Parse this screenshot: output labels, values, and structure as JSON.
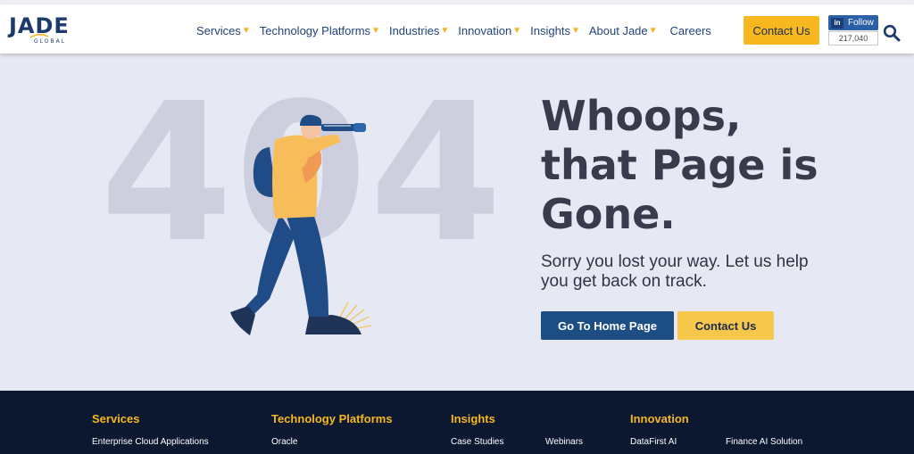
{
  "header": {
    "logo": {
      "word": "JADE",
      "sub": "GLOBAL"
    },
    "nav": [
      {
        "label": "Services",
        "caret": "▼"
      },
      {
        "label": "Technology Platforms",
        "caret": "▼"
      },
      {
        "label": "Industries",
        "caret": "▼"
      },
      {
        "label": "Innovation",
        "caret": "▼"
      },
      {
        "label": "Insights",
        "caret": "▼"
      },
      {
        "label": "About Jade",
        "caret": "▼"
      },
      {
        "label": "Careers",
        "caret": ""
      }
    ],
    "contact_button": "Contact Us",
    "linkedin": {
      "logo": "in",
      "follow": "Follow",
      "count": "217,040"
    },
    "search_icon": "search-icon"
  },
  "main": {
    "big_number": "404",
    "headline": [
      "Whoops,",
      "that Page is",
      "Gone."
    ],
    "subtext": "Sorry you lost your way. Let us help you get back on track.",
    "home_button": "Go To Home Page",
    "contact_button": "Contact Us",
    "illustration": "man-with-telescope"
  },
  "footer": {
    "columns": [
      {
        "heading": "Services",
        "links": [
          "Enterprise Cloud Applications"
        ]
      },
      {
        "heading": "Technology Platforms",
        "links": [
          "Oracle"
        ]
      },
      {
        "heading": "Insights",
        "links": [
          "Case Studies",
          "Webinars"
        ]
      },
      {
        "heading": "Innovation",
        "links": [
          "DataFirst AI",
          "Finance AI Solution"
        ]
      }
    ]
  },
  "colors": {
    "brand_navy": "#1c4e84",
    "accent_yellow": "#f6b71f",
    "page_bg": "#e6e8f3",
    "footer_bg": "#0b1830",
    "text_nav": "#21447a"
  }
}
